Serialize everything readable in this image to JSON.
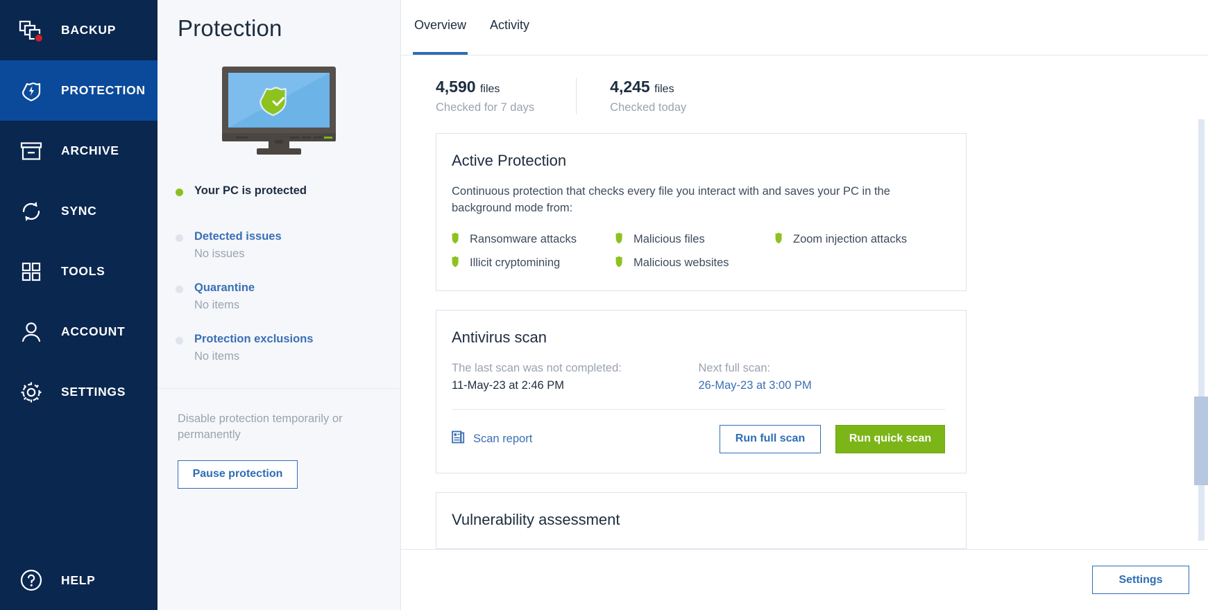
{
  "colors": {
    "sidebar_bg": "#0a2750",
    "sidebar_active": "#0b4a9a",
    "accent_blue": "#2e6cb5",
    "link_blue": "#3a6fb5",
    "green": "#7cb518",
    "shield_green": "#8dc21f",
    "screen_blue": "#6cb3e8",
    "bezel": "#55504b",
    "panel_bg": "#f5f7fb",
    "muted_text": "#9aa3af",
    "badge_red": "#cc2028"
  },
  "sidebar": {
    "items": [
      {
        "label": "BACKUP",
        "icon": "stacked-files-icon",
        "active": false,
        "badge": true
      },
      {
        "label": "PROTECTION",
        "icon": "shield-bolt-icon",
        "active": true,
        "badge": false
      },
      {
        "label": "ARCHIVE",
        "icon": "archive-box-icon",
        "active": false,
        "badge": false
      },
      {
        "label": "SYNC",
        "icon": "sync-arrows-icon",
        "active": false,
        "badge": false
      },
      {
        "label": "TOOLS",
        "icon": "grid-squares-icon",
        "active": false,
        "badge": false
      },
      {
        "label": "ACCOUNT",
        "icon": "person-icon",
        "active": false,
        "badge": false
      },
      {
        "label": "SETTINGS",
        "icon": "gear-icon",
        "active": false,
        "badge": false
      }
    ],
    "help": {
      "label": "HELP",
      "icon": "question-circle-icon"
    }
  },
  "panel": {
    "title": "Protection",
    "illustration": "monitor-with-shield-illustration",
    "status": [
      {
        "title": "Your PC is protected",
        "sub": "",
        "dot": "green",
        "link": false
      },
      {
        "title": "Detected issues",
        "sub": "No issues",
        "dot": "grey",
        "link": true
      },
      {
        "title": "Quarantine",
        "sub": "No items",
        "dot": "grey",
        "link": true
      },
      {
        "title": "Protection exclusions",
        "sub": "No items",
        "dot": "grey",
        "link": true
      }
    ],
    "footer_note": "Disable protection temporarily or permanently",
    "pause_button": "Pause protection"
  },
  "main": {
    "tabs": [
      {
        "label": "Overview",
        "active": true
      },
      {
        "label": "Activity",
        "active": false
      }
    ],
    "stats": [
      {
        "number": "4,590",
        "unit": "files",
        "sub": "Checked for 7 days"
      },
      {
        "number": "4,245",
        "unit": "files",
        "sub": "Checked today"
      }
    ],
    "active_protection": {
      "title": "Active Protection",
      "description": "Continuous protection that checks every file you interact with and saves your PC in the background mode from:",
      "features": [
        "Ransomware attacks",
        "Malicious files",
        "Zoom injection attacks",
        "Illicit cryptomining",
        "Malicious websites"
      ]
    },
    "antivirus_scan": {
      "title": "Antivirus scan",
      "last_scan_label": "The last scan was not completed:",
      "last_scan_value": "11-May-23 at 2:46 PM",
      "next_scan_label": "Next full scan:",
      "next_scan_value": "26-May-23 at 3:00 PM",
      "scan_report_label": "Scan report",
      "scan_report_icon": "document-report-icon",
      "run_full_scan": "Run full scan",
      "run_quick_scan": "Run quick scan"
    },
    "vulnerability": {
      "title": "Vulnerability assessment"
    },
    "footer": {
      "settings_button": "Settings"
    }
  }
}
